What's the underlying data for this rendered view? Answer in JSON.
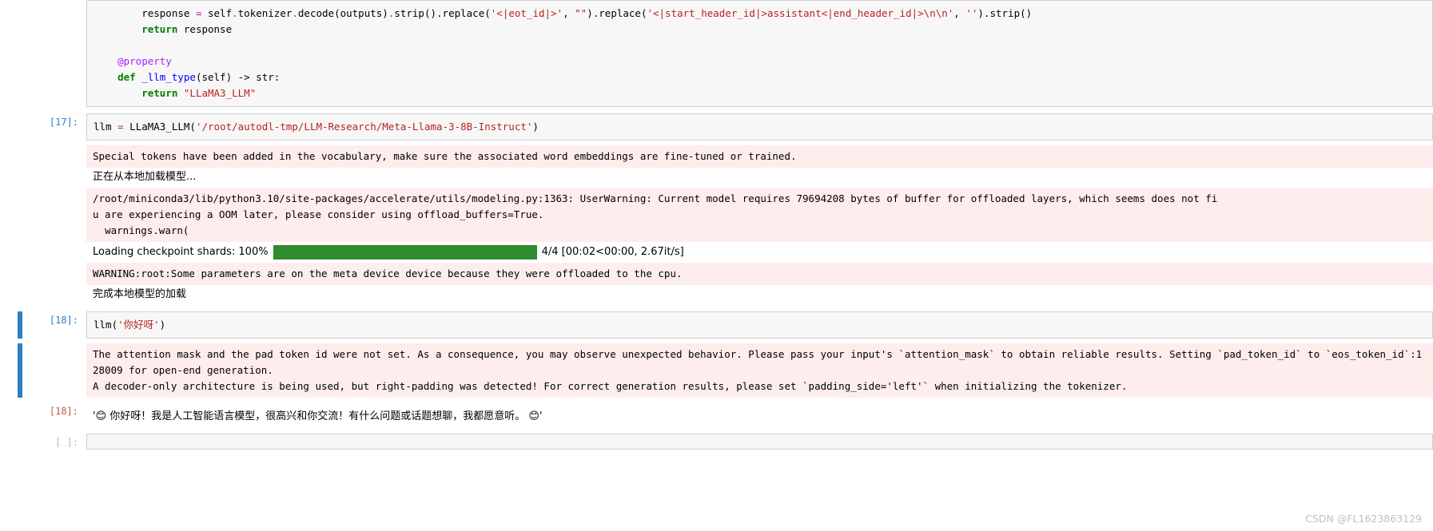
{
  "cells": {
    "c0": {
      "code_line1_prefix": "        response ",
      "code_line1_eq": "= ",
      "code_line1_self": "self",
      "code_line1_tok": "tokenizer",
      "code_line1_dec": "decode",
      "code_line1_outs": "(outputs)",
      "code_line1_strip": "strip",
      "code_line1_rep": "replace",
      "code_line1_s1": "'<|eot_id|>'",
      "code_line1_c1": ", ",
      "code_line1_e1": "\"\"",
      "code_line1_s2": "'<|start_header_id|>assistant<|end_header_id|>\\n\\n'",
      "code_line1_e2": "''",
      "code_line2_ret": "return",
      "code_line2_val": " response",
      "code_line3_prop": "@property",
      "code_line4_def": "def ",
      "code_line4_name": "_llm_type",
      "code_line4_sig": "(self) -> str:",
      "code_line5_ret": "return ",
      "code_line5_val": "\"LLaMA3_LLM\""
    },
    "c1": {
      "prompt": "[17]:",
      "line1_a": "llm ",
      "line1_eq": "= ",
      "line1_cls": "LLaMA3_LLM(",
      "line1_path": "'/root/autodl-tmp/LLM-Research/Meta-Llama-3-8B-Instruct'",
      "line1_close": ")"
    },
    "o1": {
      "stderr1": "Special tokens have been added in the vocabulary, make sure the associated word embeddings are fine-tuned or trained.",
      "stdout1": "正在从本地加载模型...",
      "stderr2": "/root/miniconda3/lib/python3.10/site-packages/accelerate/utils/modeling.py:1363: UserWarning: Current model requires 79694208 bytes of buffer for offloaded layers, which seems does not fi\nu are experiencing a OOM later, please consider using offload_buffers=True.\n  warnings.warn(",
      "progress_label": "Loading checkpoint shards: 100%",
      "progress_suffix": "4/4 [00:02<00:00, 2.67it/s]",
      "stderr3": "WARNING:root:Some parameters are on the meta device device because they were offloaded to the cpu.",
      "stdout2": "完成本地模型的加载"
    },
    "c2": {
      "prompt": "[18]:",
      "line1_a": "llm(",
      "line1_s": "'你好呀'",
      "line1_c": ")"
    },
    "o2": {
      "stderr": "The attention mask and the pad token id were not set. As a consequence, you may observe unexpected behavior. Please pass your input's `attention_mask` to obtain reliable results. Setting `pad_token_id` to `eos_token_id`:128009 for open-end generation.\nA decoder-only architecture is being used, but right-padding was detected! For correct generation results, please set `padding_side='left'` when initializing the tokenizer."
    },
    "c3": {
      "prompt": "[18]:",
      "out": "'😊 你好呀！我是人工智能语言模型，很高兴和你交流！有什么问题或话题想聊，我都愿意听。 😊'"
    },
    "c4": {
      "prompt": "[ ]:"
    }
  },
  "watermark": "CSDN @FL1623863129"
}
